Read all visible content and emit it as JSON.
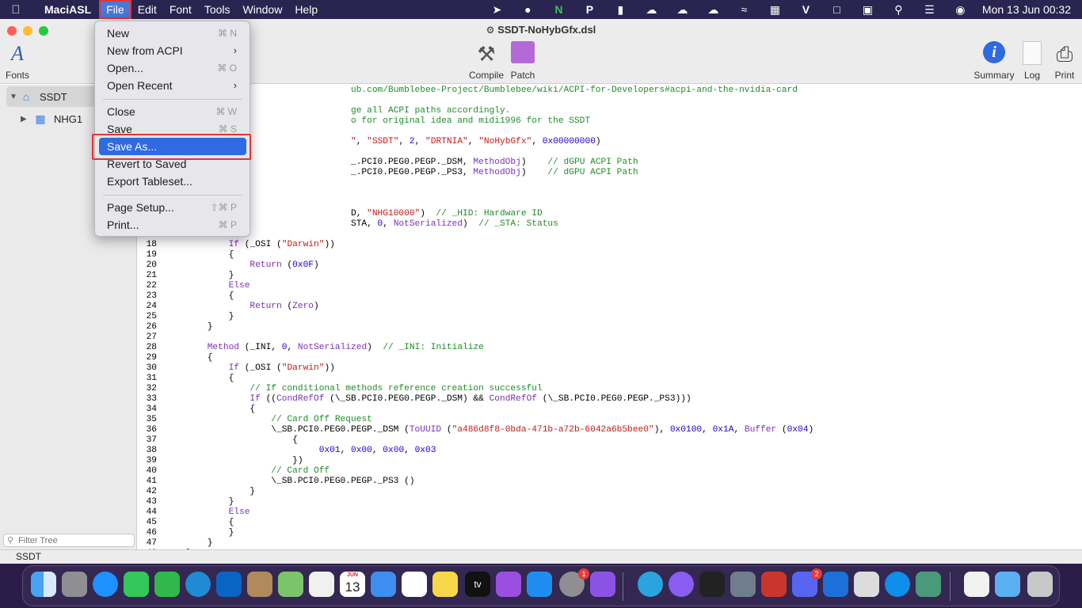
{
  "menubar": {
    "app_name": "MaciASL",
    "menus": [
      "File",
      "Edit",
      "Font",
      "Tools",
      "Window",
      "Help"
    ],
    "clock": "Mon 13 Jun  00:32",
    "badge_count": "2"
  },
  "window": {
    "title": "SSDT-NoHybGfx.dsl",
    "toolbar": {
      "fonts": "Fonts",
      "compile": "Compile",
      "patch": "Patch",
      "summary": "Summary",
      "log": "Log",
      "print": "Print"
    }
  },
  "sidebar": {
    "items": [
      {
        "label": "SSDT"
      },
      {
        "label": "NHG1"
      }
    ],
    "filter_placeholder": "Filter Tree"
  },
  "statusbar": {
    "text": "SSDT"
  },
  "file_menu": {
    "items": [
      {
        "label": "New",
        "shortcut": "⌘ N"
      },
      {
        "label": "New from ACPI",
        "shortcut": ""
      },
      {
        "label": "Open...",
        "shortcut": "⌘ O"
      },
      {
        "label": "Open Recent",
        "shortcut": ""
      },
      {
        "label": "Close",
        "shortcut": "⌘ W"
      },
      {
        "label": "Save",
        "shortcut": "⌘ S"
      },
      {
        "label": "Save As...",
        "shortcut": ""
      },
      {
        "label": "Revert to Saved",
        "shortcut": ""
      },
      {
        "label": "Export Tableset...",
        "shortcut": ""
      },
      {
        "label": "Page Setup...",
        "shortcut": "⇧⌘ P"
      },
      {
        "label": "Print...",
        "shortcut": "⌘ P"
      }
    ]
  },
  "code_lines": [
    {
      "num": "",
      "html": "                                   <span class=\"cm\">ub.com/Bumblebee-Project/Bumblebee/wiki/ACPI-for-Developers#acpi-and-the-nvidia-card</span>"
    },
    {
      "num": "",
      "html": ""
    },
    {
      "num": "",
      "html": "                                   <span class=\"cm\">ge all ACPI paths accordingly.</span>"
    },
    {
      "num": "",
      "html": "                                   <span class=\"cm\">o for original idea and midi1996 for the SSDT</span>"
    },
    {
      "num": "",
      "html": ""
    },
    {
      "num": "",
      "html": "                                   <span class=\"st\">\"</span>, <span class=\"st\">\"SSDT\"</span>, <span class=\"nm\">2</span>, <span class=\"st\">\"DRTNIA\"</span>, <span class=\"st\">\"NoHybGfx\"</span>, <span class=\"nm\">0x00000000</span>)"
    },
    {
      "num": "",
      "html": ""
    },
    {
      "num": "",
      "html": "                                   _.PCI0.PEG0.PEGP._DSM, <span class=\"kw\">MethodObj</span>)    <span class=\"cm\">// dGPU ACPI Path</span>"
    },
    {
      "num": "",
      "html": "                                   _.PCI0.PEG0.PEGP._PS3, <span class=\"kw\">MethodObj</span>)    <span class=\"cm\">// dGPU ACPI Path</span>"
    },
    {
      "num": "",
      "html": ""
    },
    {
      "num": "",
      "html": ""
    },
    {
      "num": "",
      "html": ""
    },
    {
      "num": "",
      "html": "                                   D, <span class=\"st\">\"NHG10000\"</span>)  <span class=\"cm\">// _HID: Hardware ID</span>"
    },
    {
      "num": "",
      "html": "                                   STA, <span class=\"nm\">0</span>, <span class=\"kw\">NotSerialized</span>)  <span class=\"cm\">// _STA: Status</span>"
    },
    {
      "num": "",
      "html": ""
    },
    {
      "num": "18",
      "html": "            <span class=\"kw\">If</span> (_OSI (<span class=\"st\">\"Darwin\"</span>))"
    },
    {
      "num": "19",
      "html": "            {"
    },
    {
      "num": "20",
      "html": "                <span class=\"kw\">Return</span> (<span class=\"nm\">0x0F</span>)"
    },
    {
      "num": "21",
      "html": "            }"
    },
    {
      "num": "22",
      "html": "            <span class=\"kw\">Else</span>"
    },
    {
      "num": "23",
      "html": "            {"
    },
    {
      "num": "24",
      "html": "                <span class=\"kw\">Return</span> (<span class=\"kw\">Zero</span>)"
    },
    {
      "num": "25",
      "html": "            }"
    },
    {
      "num": "26",
      "html": "        }"
    },
    {
      "num": "27",
      "html": ""
    },
    {
      "num": "28",
      "html": "        <span class=\"kw\">Method</span> (_INI, <span class=\"nm\">0</span>, <span class=\"kw\">NotSerialized</span>)  <span class=\"cm\">// _INI: Initialize</span>"
    },
    {
      "num": "29",
      "html": "        {"
    },
    {
      "num": "30",
      "html": "            <span class=\"kw\">If</span> (_OSI (<span class=\"st\">\"Darwin\"</span>))"
    },
    {
      "num": "31",
      "html": "            {"
    },
    {
      "num": "32",
      "html": "                <span class=\"cm\">// If conditional methods reference creation successful</span>"
    },
    {
      "num": "33",
      "html": "                <span class=\"kw\">If</span> ((<span class=\"kw\">CondRefOf</span> (\\_SB.PCI0.PEG0.PEGP._DSM) &amp;&amp; <span class=\"kw\">CondRefOf</span> (\\_SB.PCI0.PEG0.PEGP._PS3)))"
    },
    {
      "num": "34",
      "html": "                {"
    },
    {
      "num": "35",
      "html": "                    <span class=\"cm\">// Card Off Request</span>"
    },
    {
      "num": "36",
      "html": "                    \\_SB.PCI0.PEG0.PEGP._DSM (<span class=\"kw\">ToUUID</span> (<span class=\"st\">\"a486d8f8-0bda-471b-a72b-6042a6b5bee0\"</span>), <span class=\"nm\">0x0100</span>, <span class=\"nm\">0x1A</span>, <span class=\"kw\">Buffer</span> (<span class=\"nm\">0x04</span>)"
    },
    {
      "num": "37",
      "html": "                        {"
    },
    {
      "num": "38",
      "html": "                             <span class=\"nm\">0x01</span>, <span class=\"nm\">0x00</span>, <span class=\"nm\">0x00</span>, <span class=\"nm\">0x03</span>"
    },
    {
      "num": "39",
      "html": "                        })"
    },
    {
      "num": "40",
      "html": "                    <span class=\"cm\">// Card Off</span>"
    },
    {
      "num": "41",
      "html": "                    \\_SB.PCI0.PEG0.PEGP._PS3 ()"
    },
    {
      "num": "42",
      "html": "                }"
    },
    {
      "num": "43",
      "html": "            }"
    },
    {
      "num": "44",
      "html": "            <span class=\"kw\">Else</span>"
    },
    {
      "num": "45",
      "html": "            {"
    },
    {
      "num": "46",
      "html": "            }"
    },
    {
      "num": "47",
      "html": "        }"
    },
    {
      "num": "48",
      "html": "    }"
    }
  ],
  "dock": {
    "badges": [
      "1",
      "2"
    ],
    "calendar_month": "JUN",
    "calendar_day": "13",
    "tv_label": "tv"
  }
}
